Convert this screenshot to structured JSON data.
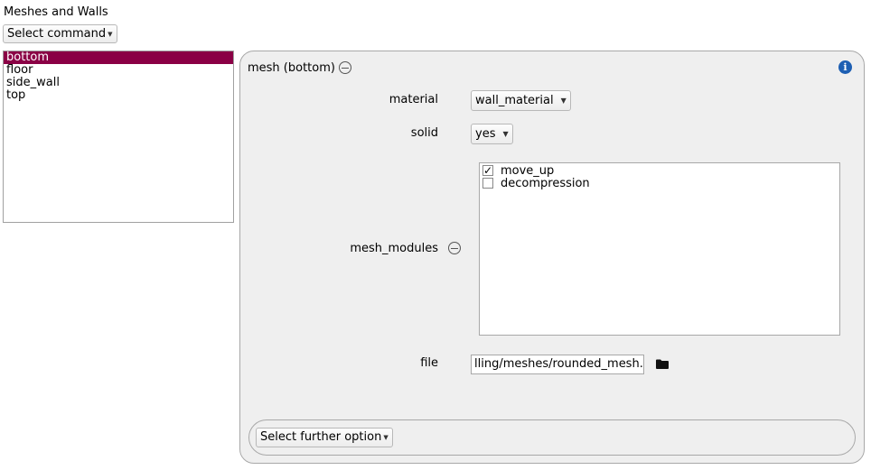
{
  "header": {
    "title": "Meshes and Walls",
    "command_button": "Select command"
  },
  "list": {
    "items": [
      {
        "label": "bottom",
        "selected": true
      },
      {
        "label": "floor",
        "selected": false
      },
      {
        "label": "side_wall",
        "selected": false
      },
      {
        "label": "top",
        "selected": false
      }
    ]
  },
  "panel": {
    "title": "mesh (bottom)",
    "material": {
      "label": "material",
      "value": "wall_material"
    },
    "solid": {
      "label": "solid",
      "value": "yes"
    },
    "mesh_modules": {
      "label": "mesh_modules",
      "options": [
        {
          "label": "move_up",
          "checked": true
        },
        {
          "label": "decompression",
          "checked": false
        }
      ]
    },
    "file": {
      "label": "file",
      "value": "lling/meshes/rounded_mesh.stl"
    },
    "further_option": "Select further option"
  },
  "colors": {
    "selection": "#8a0045",
    "info": "#1d5fb3",
    "panel_bg": "#efefef"
  }
}
